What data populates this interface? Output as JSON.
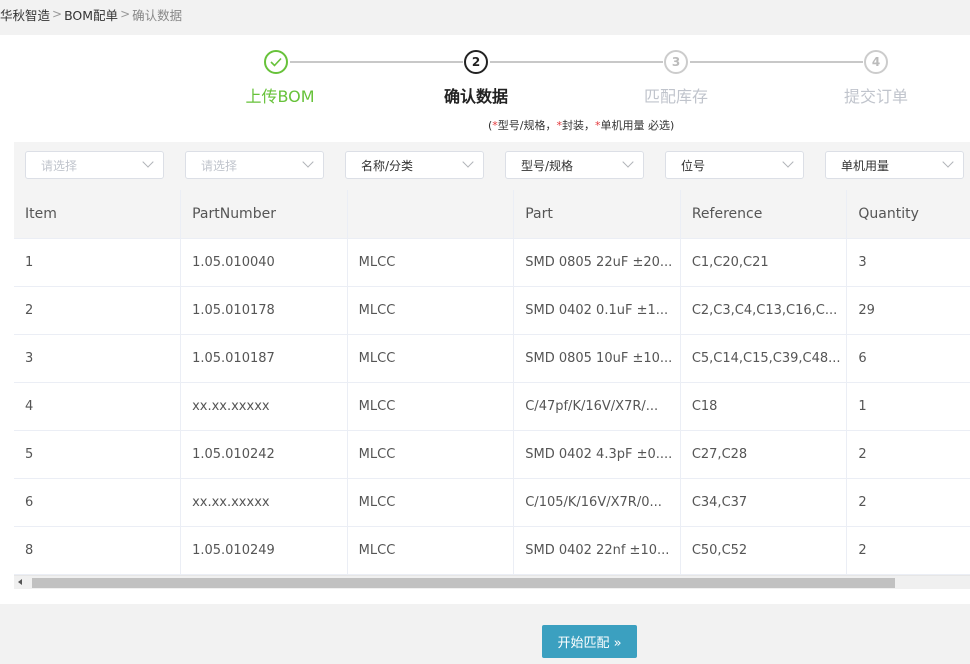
{
  "breadcrumb": {
    "items": [
      "华秋智造",
      "BOM配单",
      "确认数据"
    ],
    "separator": ">"
  },
  "steps": [
    {
      "index": "1",
      "title": "上传BOM",
      "state": "done",
      "icon": "check-icon"
    },
    {
      "index": "2",
      "title": "确认数据",
      "state": "active"
    },
    {
      "index": "3",
      "title": "匹配库存",
      "state": "pending"
    },
    {
      "index": "4",
      "title": "提交订单",
      "state": "pending"
    }
  ],
  "hint": {
    "open": "(",
    "star": "*",
    "part1": "型号/规格，",
    "part2": "封装，",
    "part3": "单机用量 必选)"
  },
  "filters": [
    {
      "value": "请选择",
      "placeholder": true
    },
    {
      "value": "请选择",
      "placeholder": true
    },
    {
      "value": "名称/分类",
      "placeholder": false
    },
    {
      "value": "型号/规格",
      "placeholder": false
    },
    {
      "value": "位号",
      "placeholder": false
    },
    {
      "value": "单机用量",
      "placeholder": false
    }
  ],
  "table": {
    "headers": [
      "Item",
      "PartNumber",
      "",
      "Part",
      "Reference",
      "Quantity"
    ],
    "rows": [
      [
        "1",
        "1.05.010040",
        "MLCC",
        "SMD 0805 22uF ±20...",
        "C1,C20,C21",
        "3"
      ],
      [
        "2",
        "1.05.010178",
        "MLCC",
        "SMD 0402 0.1uF ±1...",
        "C2,C3,C4,C13,C16,C...",
        "29"
      ],
      [
        "3",
        "1.05.010187",
        "MLCC",
        "SMD 0805 10uF ±10...",
        "C5,C14,C15,C39,C48...",
        "6"
      ],
      [
        "4",
        "xx.xx.xxxxx",
        "MLCC",
        "C/47pf/K/16V/X7R/...",
        "C18",
        "1"
      ],
      [
        "5",
        "1.05.010242",
        "MLCC",
        "SMD 0402 4.3pF ±0....",
        "C27,C28",
        "2"
      ],
      [
        "6",
        "xx.xx.xxxxx",
        "MLCC",
        "C/105/K/16V/X7R/0...",
        "C34,C37",
        "2"
      ],
      [
        "8",
        "1.05.010249",
        "MLCC",
        "SMD 0402 22nf ±10...",
        "C50,C52",
        "2"
      ]
    ]
  },
  "actions": {
    "start_match": "开始匹配 »"
  },
  "colors": {
    "done": "#67c23a",
    "button": "#3ba0c0",
    "required": "#e4393c"
  }
}
